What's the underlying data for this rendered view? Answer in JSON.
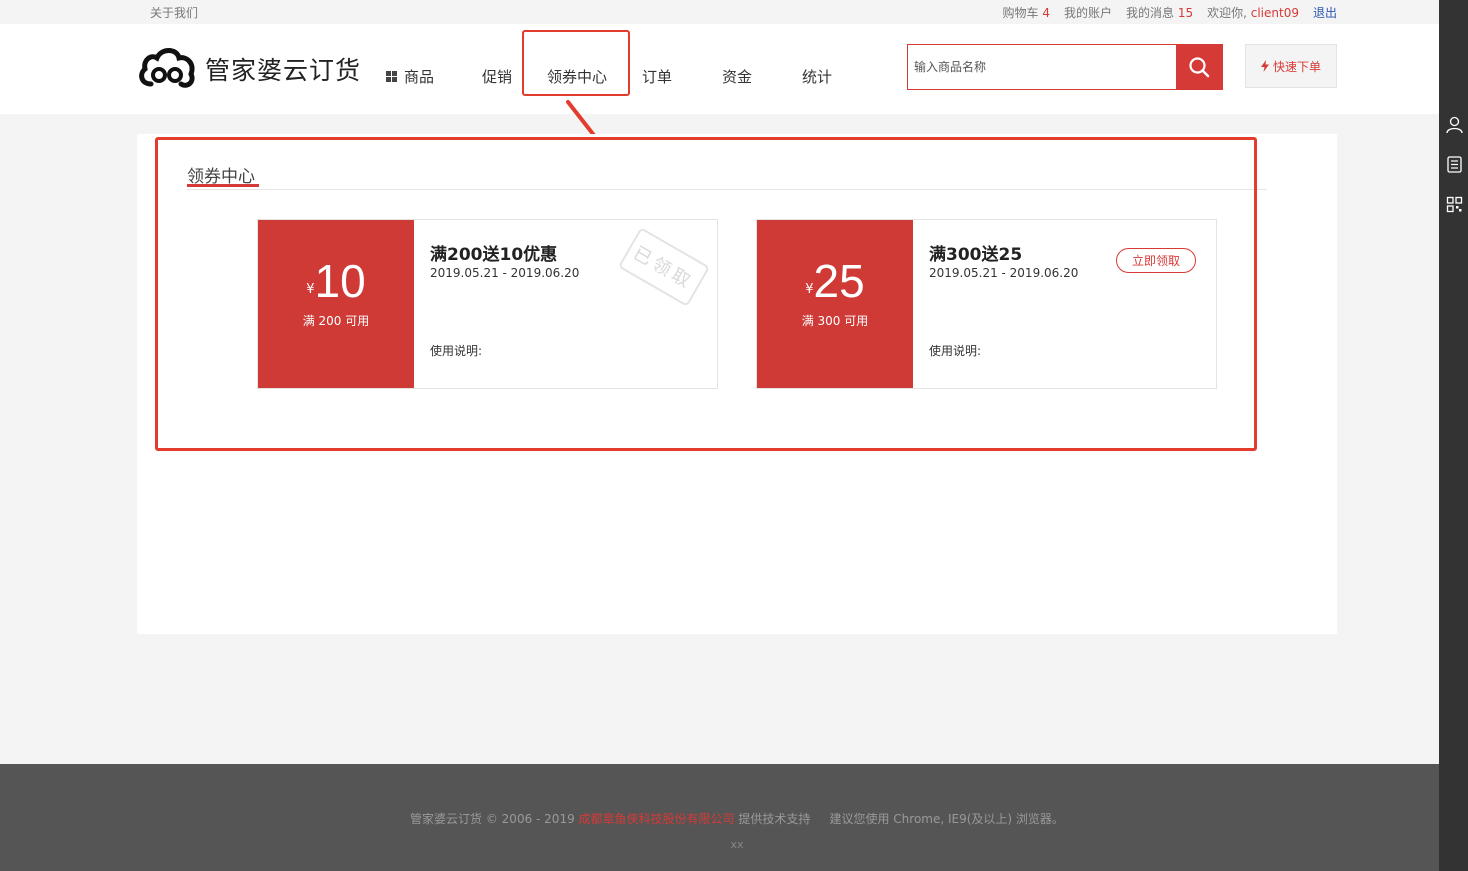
{
  "topbar": {
    "about": "关于我们",
    "cart_label": "购物车",
    "cart_count": "4",
    "account": "我的账户",
    "messages_label": "我的消息",
    "messages_count": "15",
    "welcome": "欢迎你,",
    "username": "client09",
    "logout": "退出"
  },
  "header": {
    "logo_text": "管家婆云订货",
    "nav": [
      {
        "label": "商品"
      },
      {
        "label": "促销"
      },
      {
        "label": "领券中心"
      },
      {
        "label": "订单"
      },
      {
        "label": "资金"
      },
      {
        "label": "统计"
      }
    ],
    "search_placeholder": "输入商品名称",
    "quick_order": "快速下单"
  },
  "main": {
    "title": "领券中心",
    "coupons": [
      {
        "currency": "¥",
        "amount": "10",
        "condition": "满 200 可用",
        "title": "满200送10优惠",
        "date": "2019.05.21 - 2019.06.20",
        "usage": "使用说明:",
        "stamp": "已领取"
      },
      {
        "currency": "¥",
        "amount": "25",
        "condition": "满 300 可用",
        "title": "满300送25",
        "date": "2019.05.21 - 2019.06.20",
        "usage": "使用说明:",
        "button": "立即领取"
      }
    ]
  },
  "footer": {
    "copyright": "管家婆云订货 © 2006 - 2019",
    "company": "成都章鱼侠科技股份有限公司",
    "support": "提供技术支持",
    "browser_tip": "建议您使用 Chrome, IE9(及以上) 浏览器。",
    "line2": "xx"
  },
  "colors": {
    "accent": "#d63a37",
    "highlight": "#e33c2d",
    "footer_bg": "#555555",
    "sidebar_bg": "#333333"
  }
}
